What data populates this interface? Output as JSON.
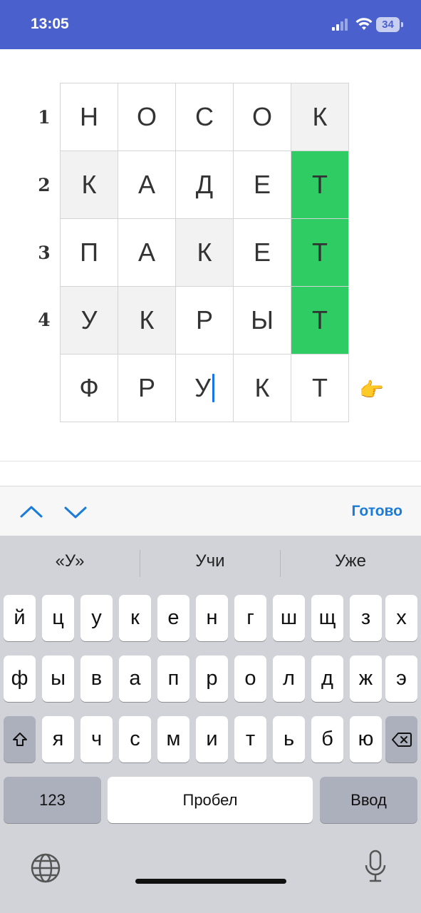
{
  "status_bar": {
    "time": "13:05",
    "battery": "34"
  },
  "puzzle": {
    "row_numbers": [
      "1",
      "2",
      "3",
      "4"
    ],
    "rows": [
      [
        "Н",
        "О",
        "С",
        "О",
        "К"
      ],
      [
        "К",
        "А",
        "Д",
        "Е",
        "Т"
      ],
      [
        "П",
        "А",
        "К",
        "Е",
        "Т"
      ],
      [
        "У",
        "К",
        "Р",
        "Ы",
        "Т"
      ],
      [
        "Ф",
        "Р",
        "У",
        "К",
        "Т"
      ]
    ],
    "pointer_glyph": "👉"
  },
  "accessory_bar": {
    "done_label": "Готово"
  },
  "keyboard": {
    "suggestions": [
      "«У»",
      "Учи",
      "Уже"
    ],
    "row1": [
      "й",
      "ц",
      "у",
      "к",
      "е",
      "н",
      "г",
      "ш",
      "щ",
      "з",
      "х"
    ],
    "row2": [
      "ф",
      "ы",
      "в",
      "а",
      "п",
      "р",
      "о",
      "л",
      "д",
      "ж",
      "э"
    ],
    "row3": [
      "я",
      "ч",
      "с",
      "м",
      "и",
      "т",
      "ь",
      "б",
      "ю"
    ],
    "numbers_label": "123",
    "space_label": "Пробел",
    "return_label": "Ввод"
  },
  "colors": {
    "status_bar": "#4a60cc",
    "correct_cell": "#2ecc62",
    "accent": "#1a7cd8"
  }
}
